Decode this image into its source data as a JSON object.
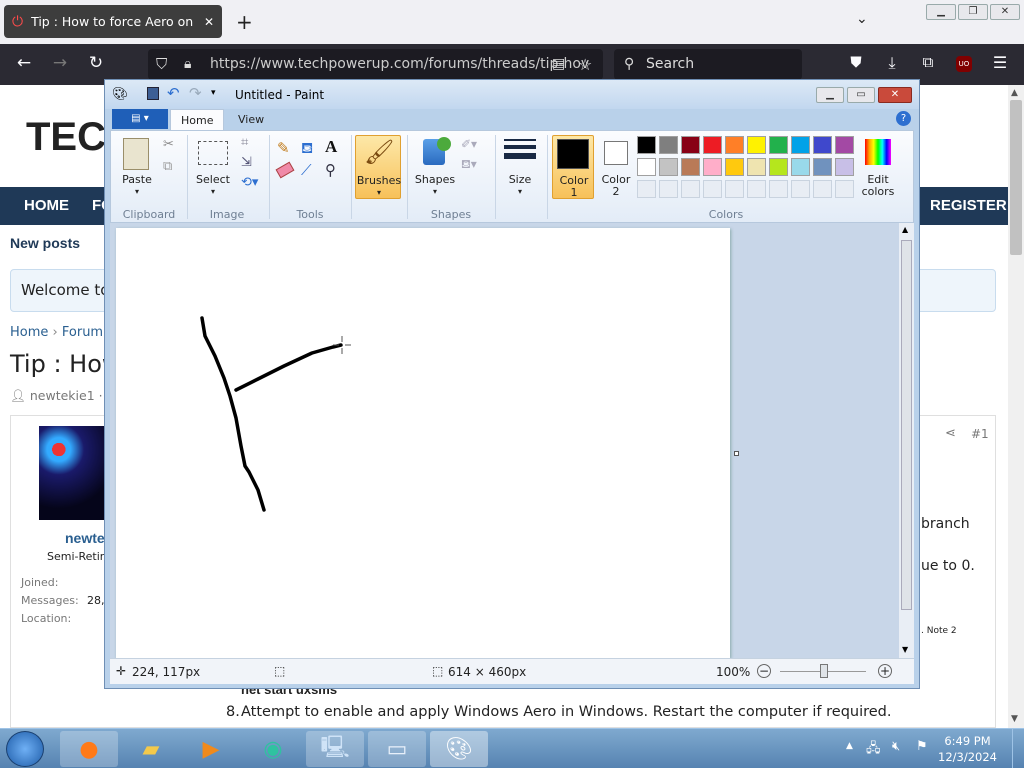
{
  "browser": {
    "tab_title": "Tip : How to force Aero on \"un",
    "url": "https://www.techpowerup.com/forums/threads/tip-hov",
    "search_placeholder": "Search",
    "new_tab": "+",
    "close_tab": "✕"
  },
  "website": {
    "logo": "TEC",
    "menu": [
      "HOME",
      "FO",
      "REGISTER"
    ],
    "new_posts": "New posts",
    "welcome": "Welcome to",
    "breadcrumb": [
      "Home",
      "Forum"
    ],
    "title": "Tip : How",
    "author": "newtekie1",
    "post_number": "#1",
    "username": "newte",
    "user_title": "Semi-Retir",
    "user_stats": [
      {
        "label": "Joined:",
        "value": ""
      },
      {
        "label": "Messages:",
        "value": "28,"
      },
      {
        "label": "Location:",
        "value": ""
      }
    ],
    "snippets": [
      "branch",
      "ue to 0.",
      ". Note 2"
    ],
    "code_line": "net start uxsms",
    "step_number": "8.",
    "step_text": "Attempt to enable and apply Windows Aero in Windows. Restart the computer if required."
  },
  "paint": {
    "window_title": "Untitled - Paint",
    "tabs": [
      "Home",
      "View"
    ],
    "groups": {
      "clipboard": "Clipboard",
      "image": "Image",
      "tools": "Tools",
      "shapes": "Shapes",
      "colors": "Colors"
    },
    "buttons": {
      "paste": "Paste",
      "select": "Select",
      "brushes": "Brushes",
      "shapes": "Shapes",
      "size": "Size",
      "color1": "Color",
      "color1_num": "1",
      "color2": "Color",
      "color2_num": "2",
      "edit_colors_1": "Edit",
      "edit_colors_2": "colors"
    },
    "palette_row1": [
      "#000000",
      "#7f7f7f",
      "#880015",
      "#ed1c24",
      "#ff7f27",
      "#fff200",
      "#22b14c",
      "#00a2e8",
      "#3f48cc",
      "#a349a4"
    ],
    "palette_row2": [
      "#ffffff",
      "#c3c3c3",
      "#b97a57",
      "#ffaec9",
      "#ffc90e",
      "#efe4b0",
      "#b5e61d",
      "#99d9ea",
      "#7092be",
      "#c8bfe7"
    ],
    "color1_value": "#000000",
    "color2_value": "#ffffff",
    "status": {
      "cursor_pos": "224, 117px",
      "canvas_size": "614 × 460px",
      "zoom": "100%"
    }
  },
  "taskbar": {
    "time": "6:49 PM",
    "date": "12/3/2024"
  }
}
